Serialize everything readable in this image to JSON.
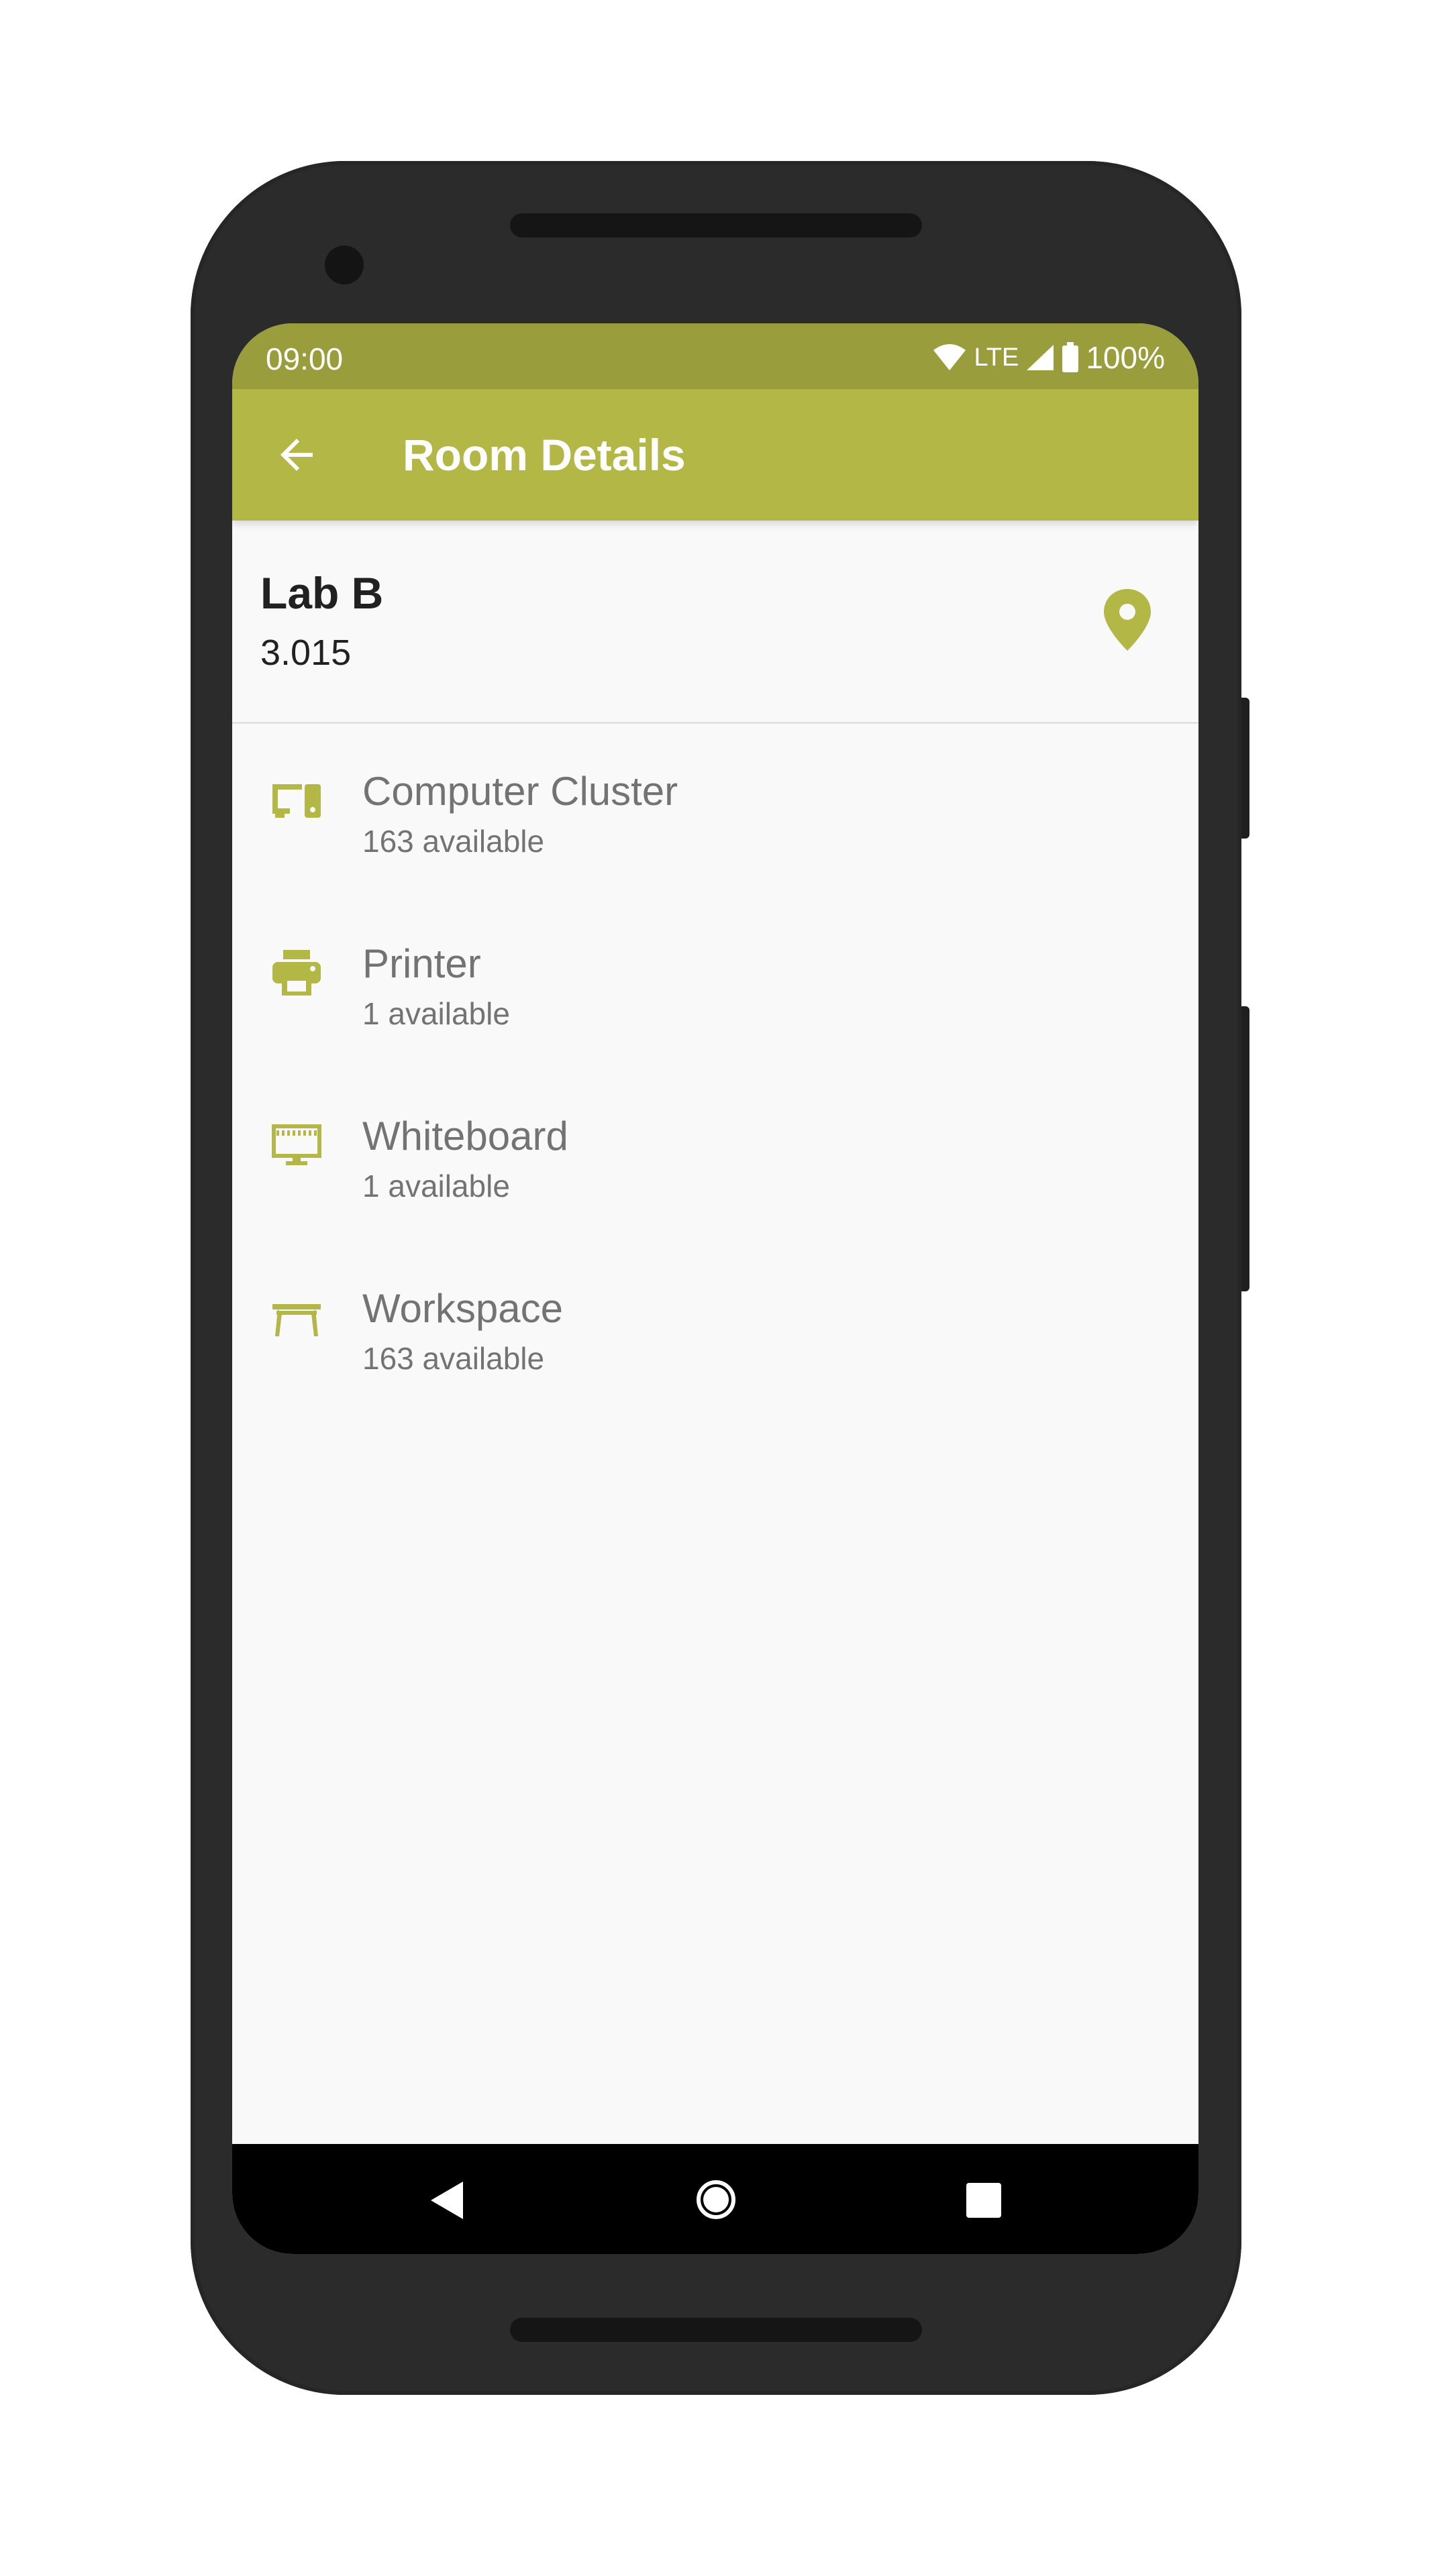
{
  "status_bar": {
    "time": "09:00",
    "network": "LTE",
    "battery": "100%"
  },
  "app_bar": {
    "title": "Room Details"
  },
  "room": {
    "name": "Lab B",
    "number": "3.015"
  },
  "items": [
    {
      "title": "Computer Cluster",
      "subtitle": "163 available",
      "icon": "computer-cluster-icon"
    },
    {
      "title": "Printer",
      "subtitle": "1 available",
      "icon": "printer-icon"
    },
    {
      "title": "Whiteboard",
      "subtitle": "1 available",
      "icon": "whiteboard-icon"
    },
    {
      "title": "Workspace",
      "subtitle": "163 available",
      "icon": "workspace-icon"
    }
  ],
  "colors": {
    "status_bar": "#9a9d3b",
    "app_bar": "#b2b745",
    "accent": "#b2b745",
    "text_primary": "#212121",
    "text_secondary": "#737373"
  }
}
